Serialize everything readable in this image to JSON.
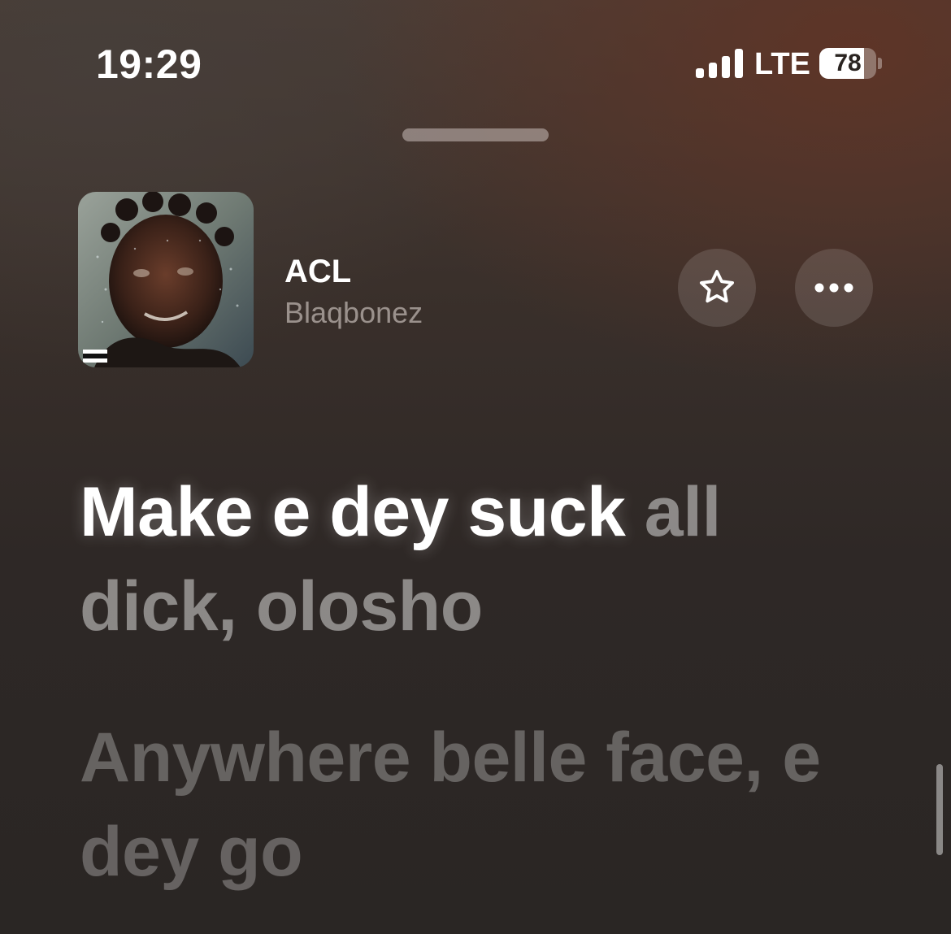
{
  "status_bar": {
    "time": "19:29",
    "network": "LTE",
    "battery_percent": "78",
    "battery_level": 0.78,
    "signal_bars": 4
  },
  "now_playing": {
    "title": "ACL",
    "artist": "Blaqbonez",
    "artwork_label": "Album artwork"
  },
  "lyrics": {
    "current_line_sung": "Make e dey suck",
    "current_line_unsung": "all dick, olosho",
    "next_line": "Anywhere belle face, e dey go"
  },
  "icons": {
    "favorite": "star-icon",
    "more": "ellipsis-icon"
  },
  "colors": {
    "text_primary": "#ffffff",
    "background_accent": "#5f3426"
  }
}
